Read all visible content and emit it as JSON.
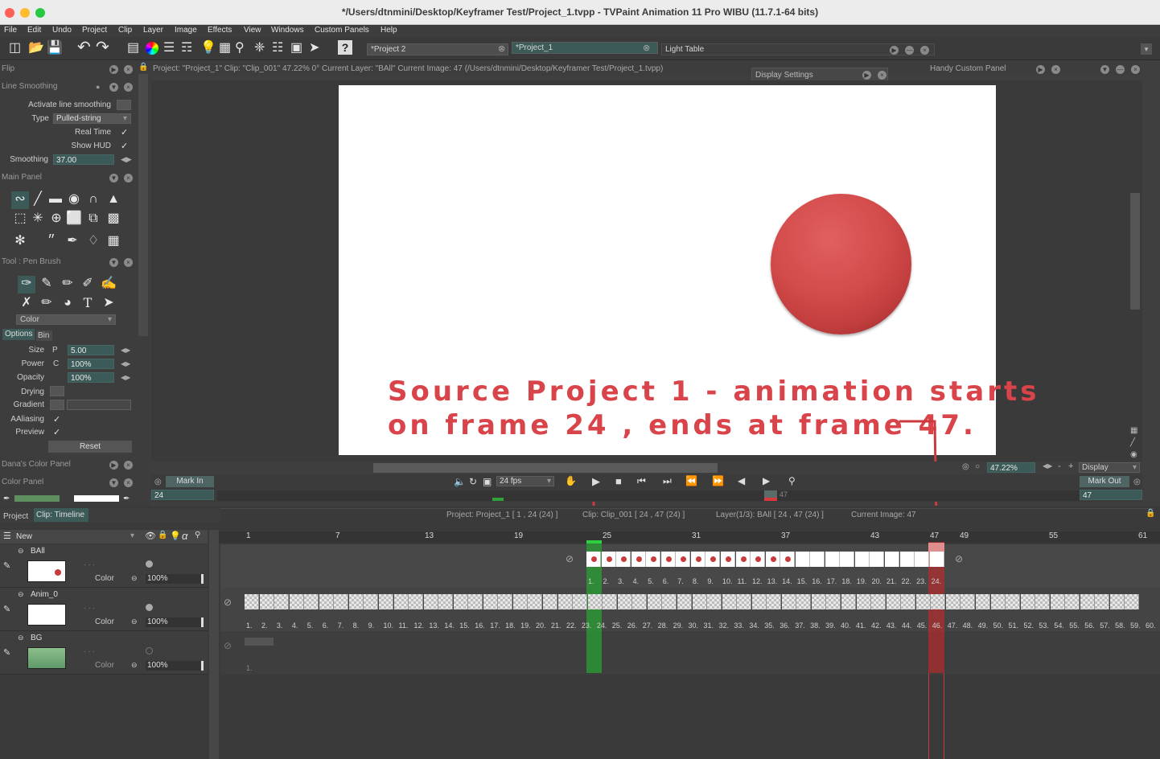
{
  "window": {
    "title": "*/Users/dtnmini/Desktop/Keyframer Test/Project_1.tvpp - TVPaint Animation 11 Pro WIBU (11.7.1-64 bits)"
  },
  "menu": [
    "File",
    "Edit",
    "Undo",
    "Project",
    "Clip",
    "Layer",
    "Image",
    "Effects",
    "View",
    "Windows",
    "Custom Panels",
    "Help"
  ],
  "tabs": {
    "project2": "*Project 2",
    "project1": "*Project_1",
    "light_table": "Light Table",
    "display_settings": "Display Settings",
    "handy_panel": "Handy Custom Panel"
  },
  "left": {
    "flip": "Flip",
    "line_smoothing": {
      "title": "Line Smoothing",
      "activate": "Activate line smoothing",
      "type_label": "Type",
      "type_value": "Pulled-string",
      "realtime": "Real Time",
      "show_hud": "Show HUD",
      "smoothing_label": "Smoothing",
      "smoothing_value": "37.00"
    },
    "main_panel": "Main Panel",
    "tool": {
      "title": "Tool : Pen Brush",
      "color": "Color",
      "tab_options": "Options",
      "tab_bin": "Bin",
      "size_label": "Size",
      "size_mod": "P",
      "size_value": "5.00",
      "power_label": "Power",
      "power_mod": "C",
      "power_value": "100%",
      "opacity_label": "Opacity",
      "opacity_value": "100%",
      "drying": "Drying",
      "gradient": "Gradient",
      "aaliasing": "AAliasing",
      "preview": "Preview",
      "reset": "Reset"
    },
    "danas_panel": "Dana's Color Panel",
    "color_panel": "Color Panel"
  },
  "info_bar": "Project: \"Project_1\"  Clip: \"Clip_001\"  47.22%   0°  Current Layer: \"BAll\"  Current Image: 47 (/Users/dtnmini/Desktop/Keyframer Test/Project_1.tvpp)",
  "annotation": "Source Project 1 - animation starts\non frame 24 , ends at frame 47.",
  "transport": {
    "mark_in": "Mark In",
    "mark_in_value": "24",
    "fps": "24 fps",
    "mark_out": "Mark Out",
    "mark_out_value": "47",
    "zoom": "47.22%",
    "display": "Display",
    "current": "47"
  },
  "timeline": {
    "tab_project": "Project",
    "tab_clip": "Clip: Timeline",
    "status_project": "Project: Project_1 [ 1 , 24  (24) ]",
    "status_clip": "Clip: Clip_001 [ 24 , 47  (24) ]",
    "status_layer": "Layer(1/3): BAll [ 24 , 47  (24) ]",
    "status_current": "Current Image: 47",
    "new_label": "New",
    "ruler": [
      "1",
      "7",
      "13",
      "19",
      "25",
      "31",
      "37",
      "43",
      "47",
      "49",
      "55",
      "61"
    ],
    "layers": [
      {
        "name": "BAll",
        "mode": "Color",
        "opacity": "100%"
      },
      {
        "name": "Anim_0",
        "mode": "Color",
        "opacity": "100%"
      },
      {
        "name": "BG",
        "mode": "Color",
        "opacity": "100%"
      }
    ],
    "ball_frames": [
      "1.",
      "2.",
      "3.",
      "4.",
      "5.",
      "6.",
      "7.",
      "8.",
      "9.",
      "10.",
      "11.",
      "12.",
      "13.",
      "14.",
      "15.",
      "16.",
      "17.",
      "18.",
      "19.",
      "20.",
      "21.",
      "22.",
      "23.",
      "24."
    ],
    "anim_frames": [
      "1.",
      "2.",
      "3.",
      "4.",
      "5.",
      "6.",
      "7.",
      "8.",
      "9.",
      "10.",
      "11.",
      "12.",
      "13.",
      "14.",
      "15.",
      "16.",
      "17.",
      "18.",
      "19.",
      "20.",
      "21.",
      "22.",
      "23.",
      "24.",
      "25.",
      "26.",
      "27.",
      "28.",
      "29.",
      "30.",
      "31.",
      "32.",
      "33.",
      "34.",
      "35.",
      "36.",
      "37.",
      "38.",
      "39.",
      "40.",
      "41.",
      "42.",
      "43.",
      "44.",
      "45.",
      "46.",
      "47.",
      "48.",
      "49.",
      "50.",
      "51.",
      "52.",
      "53.",
      "54.",
      "55.",
      "56.",
      "57.",
      "58.",
      "59.",
      "60."
    ],
    "bg_frame": "1."
  },
  "colors": {
    "accent": "#d9434a",
    "field": "#3b5a58",
    "green": "#2fa33a"
  }
}
